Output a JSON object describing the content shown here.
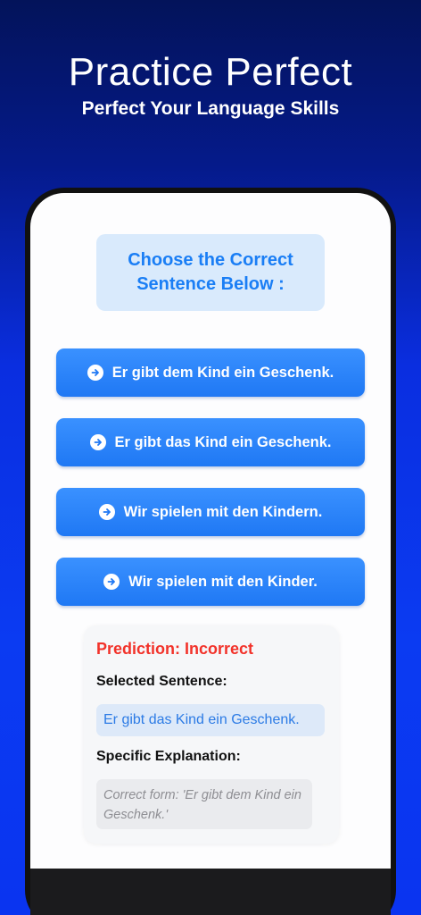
{
  "header": {
    "title": "Practice Perfect",
    "subtitle": "Perfect Your Language Skills"
  },
  "quiz": {
    "prompt": "Choose the Correct Sentence Below :",
    "options": [
      {
        "label": "Er gibt dem Kind ein Geschenk.",
        "icon": "arrow-circle-right-icon"
      },
      {
        "label": "Er gibt das Kind ein Geschenk.",
        "icon": "arrow-circle-right-icon"
      },
      {
        "label": "Wir spielen mit den Kindern.",
        "icon": "arrow-circle-right-icon"
      },
      {
        "label": "Wir spielen mit den Kinder.",
        "icon": "arrow-circle-right-icon"
      }
    ]
  },
  "result": {
    "prediction": "Prediction: Incorrect",
    "selected_label": "Selected Sentence:",
    "selected_value": "Er gibt das Kind ein Geschenk.",
    "explanation_label": "Specific Explanation:",
    "explanation_value": "Correct form: 'Er gibt dem Kind ein Geschenk.'"
  },
  "colors": {
    "accent": "#1f78f4",
    "error": "#f2322a",
    "background_top": "#03135a",
    "background_bottom": "#0a34f0"
  }
}
